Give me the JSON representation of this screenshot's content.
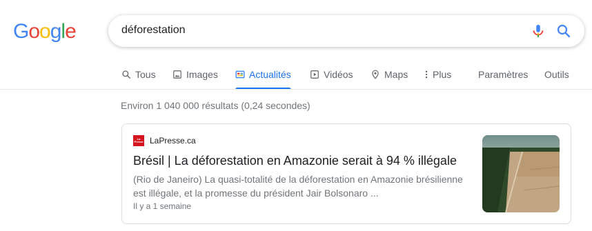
{
  "logo": {
    "letters": [
      "G",
      "o",
      "o",
      "g",
      "l",
      "e"
    ],
    "colors": [
      "#4285f4",
      "#ea4335",
      "#fbbc05",
      "#4285f4",
      "#34a853",
      "#ea4335"
    ]
  },
  "search": {
    "query": "déforestation",
    "mic_icon": "microphone-icon",
    "search_icon": "search-icon"
  },
  "tabs": [
    {
      "label": "Tous",
      "icon": "search-icon",
      "active": false
    },
    {
      "label": "Images",
      "icon": "image-icon",
      "active": false
    },
    {
      "label": "Actualités",
      "icon": "news-icon",
      "active": true
    },
    {
      "label": "Vidéos",
      "icon": "video-icon",
      "active": false
    },
    {
      "label": "Maps",
      "icon": "map-pin-icon",
      "active": false
    },
    {
      "label": "Plus",
      "icon": "more-vertical-icon",
      "active": false
    }
  ],
  "tools": {
    "settings_label": "Paramètres",
    "tools_label": "Outils"
  },
  "result_stats": "Environ 1 040 000 résultats (0,24 secondes)",
  "news_result": {
    "source": "LaPresse.ca",
    "favicon_text": "La Presse",
    "title": "Brésil | La déforestation en Amazonie serait à 94 % illégale",
    "snippet": "(Rio de Janeiro) La quasi-totalité de la déforestation en Amazonie brésilienne est illégale, et la promesse du président Jair Bolsonaro ...",
    "age": "Il y a 1 semaine"
  },
  "colors": {
    "accent": "#1a73e8",
    "text_secondary": "#70757a",
    "favicon_red": "#d3141d"
  }
}
